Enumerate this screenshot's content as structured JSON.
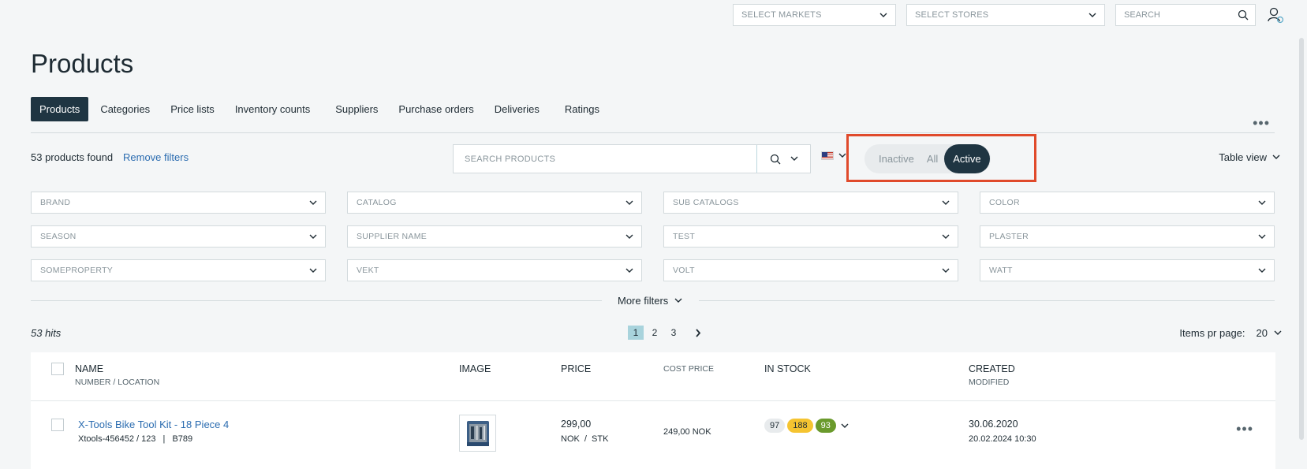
{
  "topbar": {
    "markets_placeholder": "SELECT MARKETS",
    "stores_placeholder": "SELECT STORES",
    "search_placeholder": "SEARCH"
  },
  "page": {
    "title": "Products"
  },
  "tabs": [
    {
      "label": "Products",
      "active": true
    },
    {
      "label": "Categories"
    },
    {
      "label": "Price lists"
    },
    {
      "label": "Inventory counts"
    },
    {
      "label": "Suppliers"
    },
    {
      "label": "Purchase orders"
    },
    {
      "label": "Deliveries"
    },
    {
      "label": "Ratings"
    }
  ],
  "toolbar": {
    "found_text": "53 products found",
    "remove_filters": "Remove filters",
    "search_placeholder": "SEARCH PRODUCTS",
    "status_toggle": {
      "inactive": "Inactive",
      "all": "All",
      "active": "Active",
      "selected": "Active"
    },
    "view_label": "Table view"
  },
  "filters": [
    "BRAND",
    "CATALOG",
    "SUB CATALOGS",
    "COLOR",
    "SEASON",
    "SUPPLIER NAME",
    "TEST",
    "PLASTER",
    "SOMEPROPERTY",
    "VEKT",
    "VOLT",
    "WATT"
  ],
  "more_filters": "More filters",
  "results": {
    "hits": "53 hits",
    "pages": [
      "1",
      "2",
      "3"
    ],
    "current_page": "1",
    "per_page_label": "Items pr page:",
    "per_page_value": "20"
  },
  "table": {
    "headers": {
      "name": "NAME",
      "name_sub": "NUMBER / LOCATION",
      "image": "IMAGE",
      "price": "PRICE",
      "cost_price": "COST PRICE",
      "in_stock": "IN STOCK",
      "created": "CREATED",
      "created_sub": "MODIFIED"
    },
    "rows": [
      {
        "name": "X-Tools Bike Tool Kit - 18 Piece 4",
        "number": "Xtools-456452 / 123",
        "separator": "|",
        "location": "B789",
        "price": "299,00",
        "price_unit": "NOK",
        "unit_sep": "/",
        "unit": "STK",
        "cost_price": "249,00 NOK",
        "stock": [
          "97",
          "188",
          "93"
        ],
        "created": "30.06.2020",
        "modified": "20.02.2024 10:30"
      }
    ]
  },
  "colors": {
    "accent_dark": "#1f3542",
    "link": "#2b6cb0",
    "highlight": "#e04a2b",
    "badge_grey": "#e8ebed",
    "badge_yellow": "#f5c431",
    "badge_green": "#6a9a2c",
    "page_active": "#a8d3dc"
  }
}
